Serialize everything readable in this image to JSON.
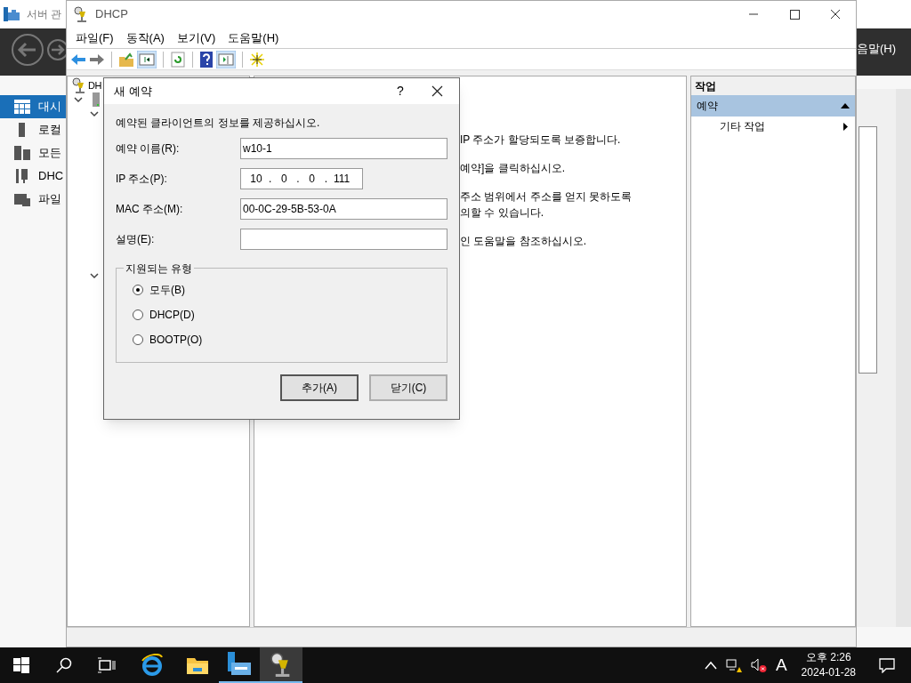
{
  "background_window": {
    "title": "서버 관",
    "menu_fragment": "음말(H)",
    "nav": [
      {
        "label": "대시",
        "selected": true
      },
      {
        "label": "로컬",
        "selected": false
      },
      {
        "label": "모든",
        "selected": false
      },
      {
        "label": "DHC",
        "selected": false
      },
      {
        "label": "파일",
        "selected": false
      }
    ]
  },
  "window": {
    "title": "DHCP",
    "menu": [
      "파일(F)",
      "동작(A)",
      "보기(V)",
      "도움말(H)"
    ],
    "tree": {
      "root": "DH"
    },
    "description": [
      "IP 주소가 할당되도록 보증합니다.",
      "예약]을 클릭하십시오.",
      "주소 범위에서 주소를 얻지 못하도록",
      "의할 수 있습니다.",
      "인 도움말을 참조하십시오."
    ],
    "actions": {
      "header": "작업",
      "section": "예약",
      "expanded": true,
      "items": [
        "기타 작업"
      ]
    }
  },
  "dialog": {
    "title": "새 예약",
    "help": "?",
    "intro": "예약된 클라이언트의 정보를 제공하십시오.",
    "fields": [
      {
        "kind": "text",
        "label": "예약 이름(R):",
        "value": "w10-1"
      },
      {
        "kind": "ip",
        "label": "IP 주소(P):",
        "octets": [
          "10",
          "0",
          "0",
          "111"
        ],
        "separator": "."
      },
      {
        "kind": "text",
        "label": "MAC 주소(M):",
        "value": "00-0C-29-5B-53-0A"
      },
      {
        "kind": "text",
        "label": "설명(E):"
      }
    ],
    "group": {
      "title": "지원되는 유형",
      "options": [
        {
          "label": "모두(B)",
          "selected": true
        },
        {
          "label": "DHCP(D)",
          "selected": false
        },
        {
          "label": "BOOTP(O)",
          "selected": false
        }
      ]
    },
    "buttons": [
      "추가(A)",
      "닫기(C)"
    ]
  },
  "taskbar": {
    "ime": "A",
    "time": "오후 2:26",
    "date": "2024-01-28"
  }
}
